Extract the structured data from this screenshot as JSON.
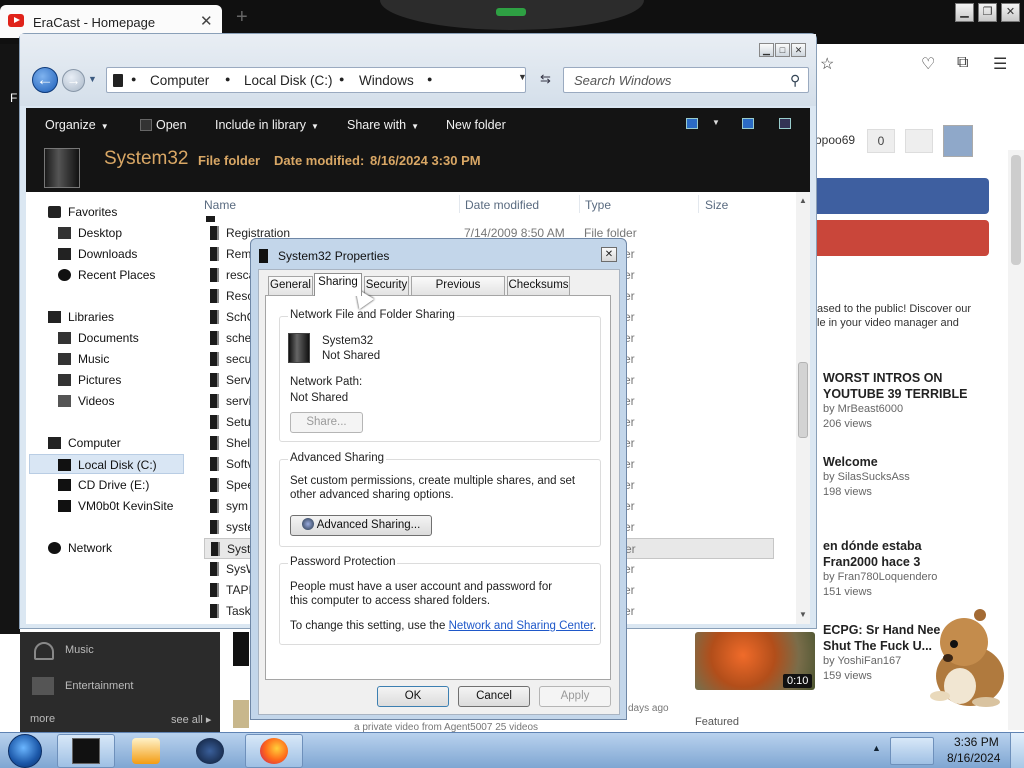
{
  "browser": {
    "tab_title": "EraCast - Homepage",
    "tab_close": "✕",
    "new_tab": "+",
    "side_letter": "F",
    "username": "opoo69",
    "user_count": "0",
    "description": "ased to the public! Discover our\nle in your video manager and",
    "videos": [
      {
        "title": "WORST INTROS ON YOUTUBE 39 TERRIBLE",
        "author": "by MrBeast6000",
        "views": "206 views"
      },
      {
        "title": "Welcome",
        "author": "by SilasSucksAss",
        "views": "198 views"
      },
      {
        "title": "en dónde estaba Fran2000 hace 3",
        "author": "by Fran780Loquendero",
        "views": "151 views"
      },
      {
        "title": "ECPG: Sr Hand Nee Shut The Fuck U...",
        "author": "by YoshiFan167",
        "views": "159 views",
        "duration": "0:10"
      }
    ],
    "featured_label": "Featured",
    "sidebar_items": [
      "Music",
      "Entertainment"
    ],
    "more_label": "more",
    "see_all_label": "see all ▸",
    "ago_text": "days ago",
    "blurb_text": "a private video from Agent5007 25 videos"
  },
  "explorer": {
    "breadcrumbs": [
      "Computer",
      "Local Disk (C:)",
      "Windows"
    ],
    "search_placeholder": "Search Windows",
    "commands": {
      "organize": "Organize",
      "open": "Open",
      "include": "Include in library",
      "share": "Share with",
      "new_folder": "New folder"
    },
    "details": {
      "name": "System32",
      "type": "File folder",
      "modified_label": "Date modified:",
      "modified_value": "8/16/2024 3:30 PM"
    },
    "nav": {
      "favorites": "Favorites",
      "desktop": "Desktop",
      "downloads": "Downloads",
      "recent": "Recent Places",
      "libraries": "Libraries",
      "documents": "Documents",
      "music": "Music",
      "pictures": "Pictures",
      "videos": "Videos",
      "computer": "Computer",
      "local_disk": "Local Disk (C:)",
      "cd_drive": "CD Drive (E:)",
      "vm": "VM0b0t KevinSite",
      "network": "Network"
    },
    "columns": {
      "name": "Name",
      "date": "Date modified",
      "type": "Type",
      "size": "Size"
    },
    "files": [
      {
        "name": "Registration",
        "date": "7/14/2009 8:50 AM",
        "type": "File folder"
      },
      {
        "name": "Rem",
        "type": "er"
      },
      {
        "name": "resca",
        "type": "er"
      },
      {
        "name": "Reso",
        "type": "er"
      },
      {
        "name": "SchC",
        "type": "er"
      },
      {
        "name": "sche",
        "type": "er"
      },
      {
        "name": "secu",
        "type": "er"
      },
      {
        "name": "Serv",
        "type": "er"
      },
      {
        "name": "servi",
        "type": "er"
      },
      {
        "name": "Setu",
        "type": "er"
      },
      {
        "name": "Shel",
        "type": "er"
      },
      {
        "name": "Softv",
        "type": "er"
      },
      {
        "name": "Spee",
        "type": "er"
      },
      {
        "name": "sym",
        "type": "er"
      },
      {
        "name": "syste",
        "type": "er"
      },
      {
        "name": "Syste",
        "type": "er"
      },
      {
        "name": "SysW",
        "type": "er"
      },
      {
        "name": "TAPI",
        "type": "er"
      },
      {
        "name": "Task",
        "type": "er"
      }
    ]
  },
  "dialog": {
    "title": "System32 Properties",
    "close": "✕",
    "tabs": [
      "General",
      "Sharing",
      "Security",
      "Previous Versions",
      "Checksums"
    ],
    "network_group_title": "Network File and Folder Sharing",
    "folder_name": "System32",
    "share_status": "Not Shared",
    "network_path_label": "Network Path:",
    "network_path_value": "Not Shared",
    "share_button": "Share...",
    "advanced_group_title": "Advanced Sharing",
    "advanced_text": "Set custom permissions, create multiple shares, and set other advanced sharing options.",
    "advanced_button": "Advanced Sharing...",
    "password_group_title": "Password Protection",
    "password_text": "People must have a user account and password for this computer to access shared folders.",
    "change_text": "To change this setting, use the",
    "link_text": "Network and Sharing Center",
    "ok": "OK",
    "cancel": "Cancel",
    "apply": "Apply"
  },
  "taskbar": {
    "time": "3:36 PM",
    "date": "8/16/2024"
  },
  "icons": [
    "youtube-favicon",
    "back-arrow-icon",
    "forward-arrow-icon",
    "refresh-icon",
    "search-icon",
    "folder-icon",
    "star-icon",
    "pocket-icon",
    "extensions-icon",
    "menu-icon",
    "shield-icon",
    "start-orb-icon",
    "firefox-icon",
    "media-player-icon",
    "globe-icon"
  ]
}
